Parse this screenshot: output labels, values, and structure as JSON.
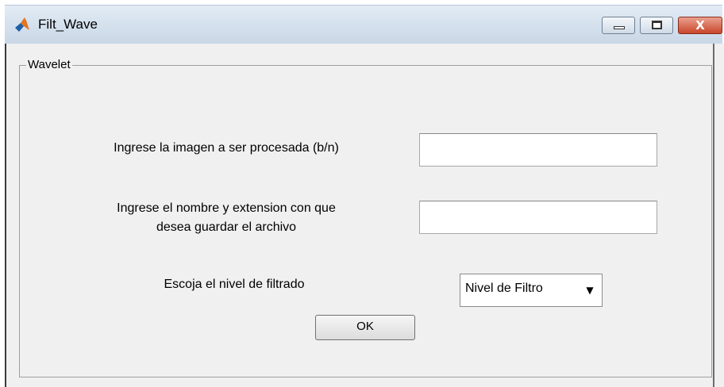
{
  "window": {
    "title": "Filt_Wave",
    "icon": "matlab-icon",
    "controls": {
      "minimize": "minimize-icon",
      "maximize": "maximize-icon",
      "close": "close-icon",
      "close_glyph": "X"
    }
  },
  "panel": {
    "title": "Wavelet",
    "image_label": "Ingrese la imagen a ser procesada (b/n)",
    "image_value": "",
    "save_label_line1": "Ingrese el nombre y extension con que",
    "save_label_line2": "desea guardar el archivo",
    "save_value": "",
    "filter_label": "Escoja el nivel de filtrado",
    "filter_selected": "Nivel de Filtro",
    "filter_arrow": "▼",
    "ok_label": "OK"
  }
}
